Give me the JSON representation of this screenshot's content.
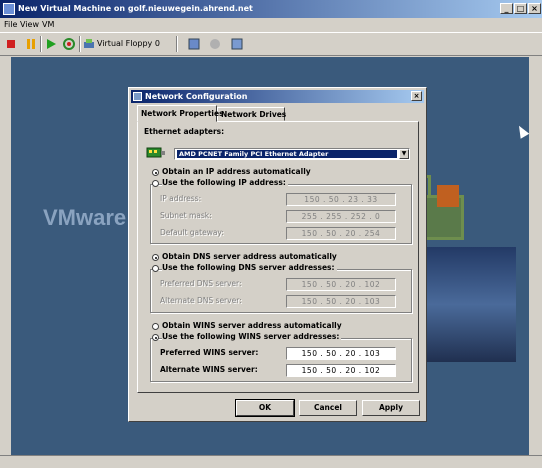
{
  "window": {
    "title": "New Virtual Machine on golf.nieuwegein.ahrend.net",
    "controls": {
      "minimize": "_",
      "maximize": "□",
      "close": "×"
    }
  },
  "menu": [
    "File",
    "View",
    "VM"
  ],
  "toolbar": {
    "floppy_label": "Virtual Floppy 0",
    "icons": [
      "stop-icon",
      "pause-icon",
      "play-icon",
      "reset-icon",
      "floppy-icon",
      "zoom-icon",
      "snapshot-icon",
      "settings-icon"
    ]
  },
  "console": {
    "brand": "VMware"
  },
  "dialog": {
    "title": "Network Configuration",
    "close": "×",
    "tabs": [
      "Network Properties",
      "Network Drives"
    ],
    "adapters_label": "Ethernet adapters:",
    "adapter_selected": "AMD PCNET Family PCI Ethernet Adapter",
    "ip": {
      "auto_label": "Obtain an IP address automatically",
      "manual_label": "Use the following IP address:",
      "fields": [
        {
          "label": "IP address:",
          "value": "150  .  50  .  23  .  33"
        },
        {
          "label": "Subnet mask:",
          "value": "255  .  255  .  252  .  0"
        },
        {
          "label": "Default gateway:",
          "value": "150  .  50  .  20  .  254"
        }
      ]
    },
    "dns": {
      "auto_label": "Obtain DNS server address automatically",
      "manual_label": "Use the following DNS server addresses:",
      "fields": [
        {
          "label": "Preferred DNS server:",
          "value": "150  .  50  .  20  .  102"
        },
        {
          "label": "Alternate DNS server:",
          "value": "150  .  50  .  20  .  103"
        }
      ]
    },
    "wins": {
      "auto_label": "Obtain WINS server address automatically",
      "manual_label": "Use the following WINS server addresses:",
      "fields": [
        {
          "label": "Preferred WINS server:",
          "value": "150  .  50  .  20  .  103"
        },
        {
          "label": "Alternate WINS server:",
          "value": "150  .  50  .  20  .  102"
        }
      ]
    },
    "buttons": {
      "ok": "OK",
      "cancel": "Cancel",
      "apply": "Apply"
    }
  },
  "colors": {
    "title_start": "#0a246a",
    "title_end": "#a6caf0",
    "desktop": "#3a5a7c",
    "face": "#d4d0c8"
  }
}
